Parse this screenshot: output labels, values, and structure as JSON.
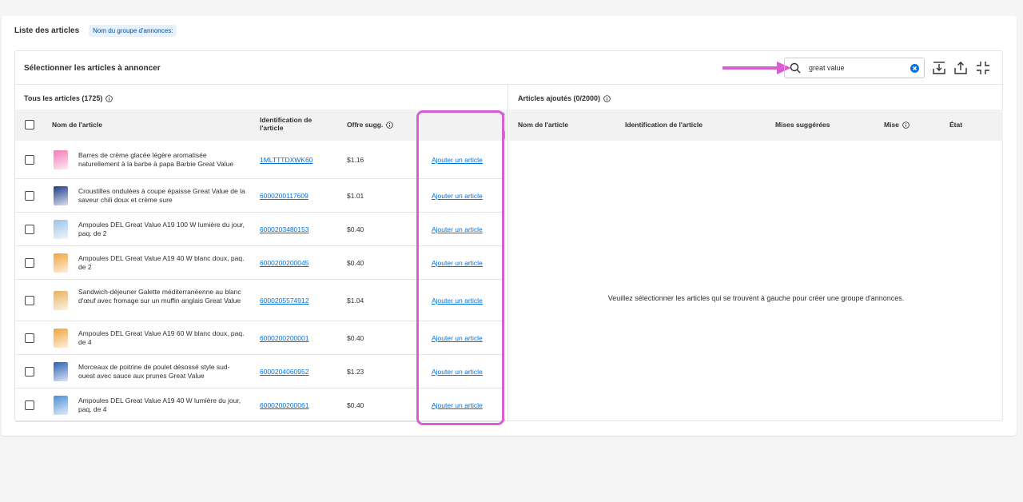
{
  "list": {
    "title": "Liste des articles",
    "group_badge": "Nom du groupe d'annonces:"
  },
  "panel": {
    "title": "Sélectionner les articles à annoncer"
  },
  "search": {
    "value": "great value",
    "icon": "search-icon"
  },
  "toolbar": {
    "icons": [
      "download-icon",
      "upload-icon",
      "collapse-icon"
    ]
  },
  "left": {
    "title": "Tous les articles (1725)",
    "columns": {
      "name": "Nom de l'article",
      "id_line1": "Identification de",
      "id_line2": "l'article",
      "offer": "Offre sugg."
    },
    "rows": [
      {
        "name": "Barres de crème glacée légère aromatisée naturellement à la barbe à papa Barbie Great Value",
        "id": "1MLTTTDXWK60",
        "price": "$1.16",
        "action": "Ajouter un article",
        "thumb_color": "#f27bb7"
      },
      {
        "name": "Croustilles ondulées à coupe épaisse Great Value de la saveur chili doux et crème sure",
        "id": "6000200117609",
        "price": "$1.01",
        "action": "Ajouter un article",
        "thumb_color": "#1f3c88"
      },
      {
        "name": "Ampoules DEL Great Value A19 100 W lumière du jour, paq. de 2",
        "id": "6000203480153",
        "price": "$0.40",
        "action": "Ajouter un article",
        "thumb_color": "#9cc3e6"
      },
      {
        "name": "Ampoules DEL Great Value A19 40 W blanc doux, paq. de 2",
        "id": "6000200200045",
        "price": "$0.40",
        "action": "Ajouter un article",
        "thumb_color": "#f2a33a"
      },
      {
        "name": "Sandwich-déjeuner Galette méditerranéenne au blanc d'œuf avec fromage sur un muffin anglais Great Value",
        "id": "6000205574912",
        "price": "$1.04",
        "action": "Ajouter un article",
        "thumb_color": "#e8b25c"
      },
      {
        "name": "Ampoules DEL Great Value A19 60 W blanc doux, paq. de 4",
        "id": "6000200200001",
        "price": "$0.40",
        "action": "Ajouter un article",
        "thumb_color": "#f2a33a"
      },
      {
        "name": "Morceaux de poitrine de poulet désossé style sud-ouest avec sauce aux prunes Great Value",
        "id": "6000204060952",
        "price": "$1.23",
        "action": "Ajouter un article",
        "thumb_color": "#2c5fb5"
      },
      {
        "name": "Ampoules DEL Great Value A19 40 W lumière du jour, paq. de 4",
        "id": "6000200200061",
        "price": "$0.40",
        "action": "Ajouter un article",
        "thumb_color": "#4a8fd6"
      }
    ]
  },
  "right": {
    "title": "Articles ajoutés (0/2000)",
    "columns": {
      "name": "Nom de l'article",
      "id": "Identification de l'article",
      "bids": "Mises suggérées",
      "bid": "Mise",
      "status": "État"
    },
    "empty_message": "Veuillez sélectionner les articles qui se trouvent à gauche pour créer une groupe d'annonces."
  },
  "colors": {
    "accent": "#0071dc",
    "highlight": "#d85fcf"
  }
}
